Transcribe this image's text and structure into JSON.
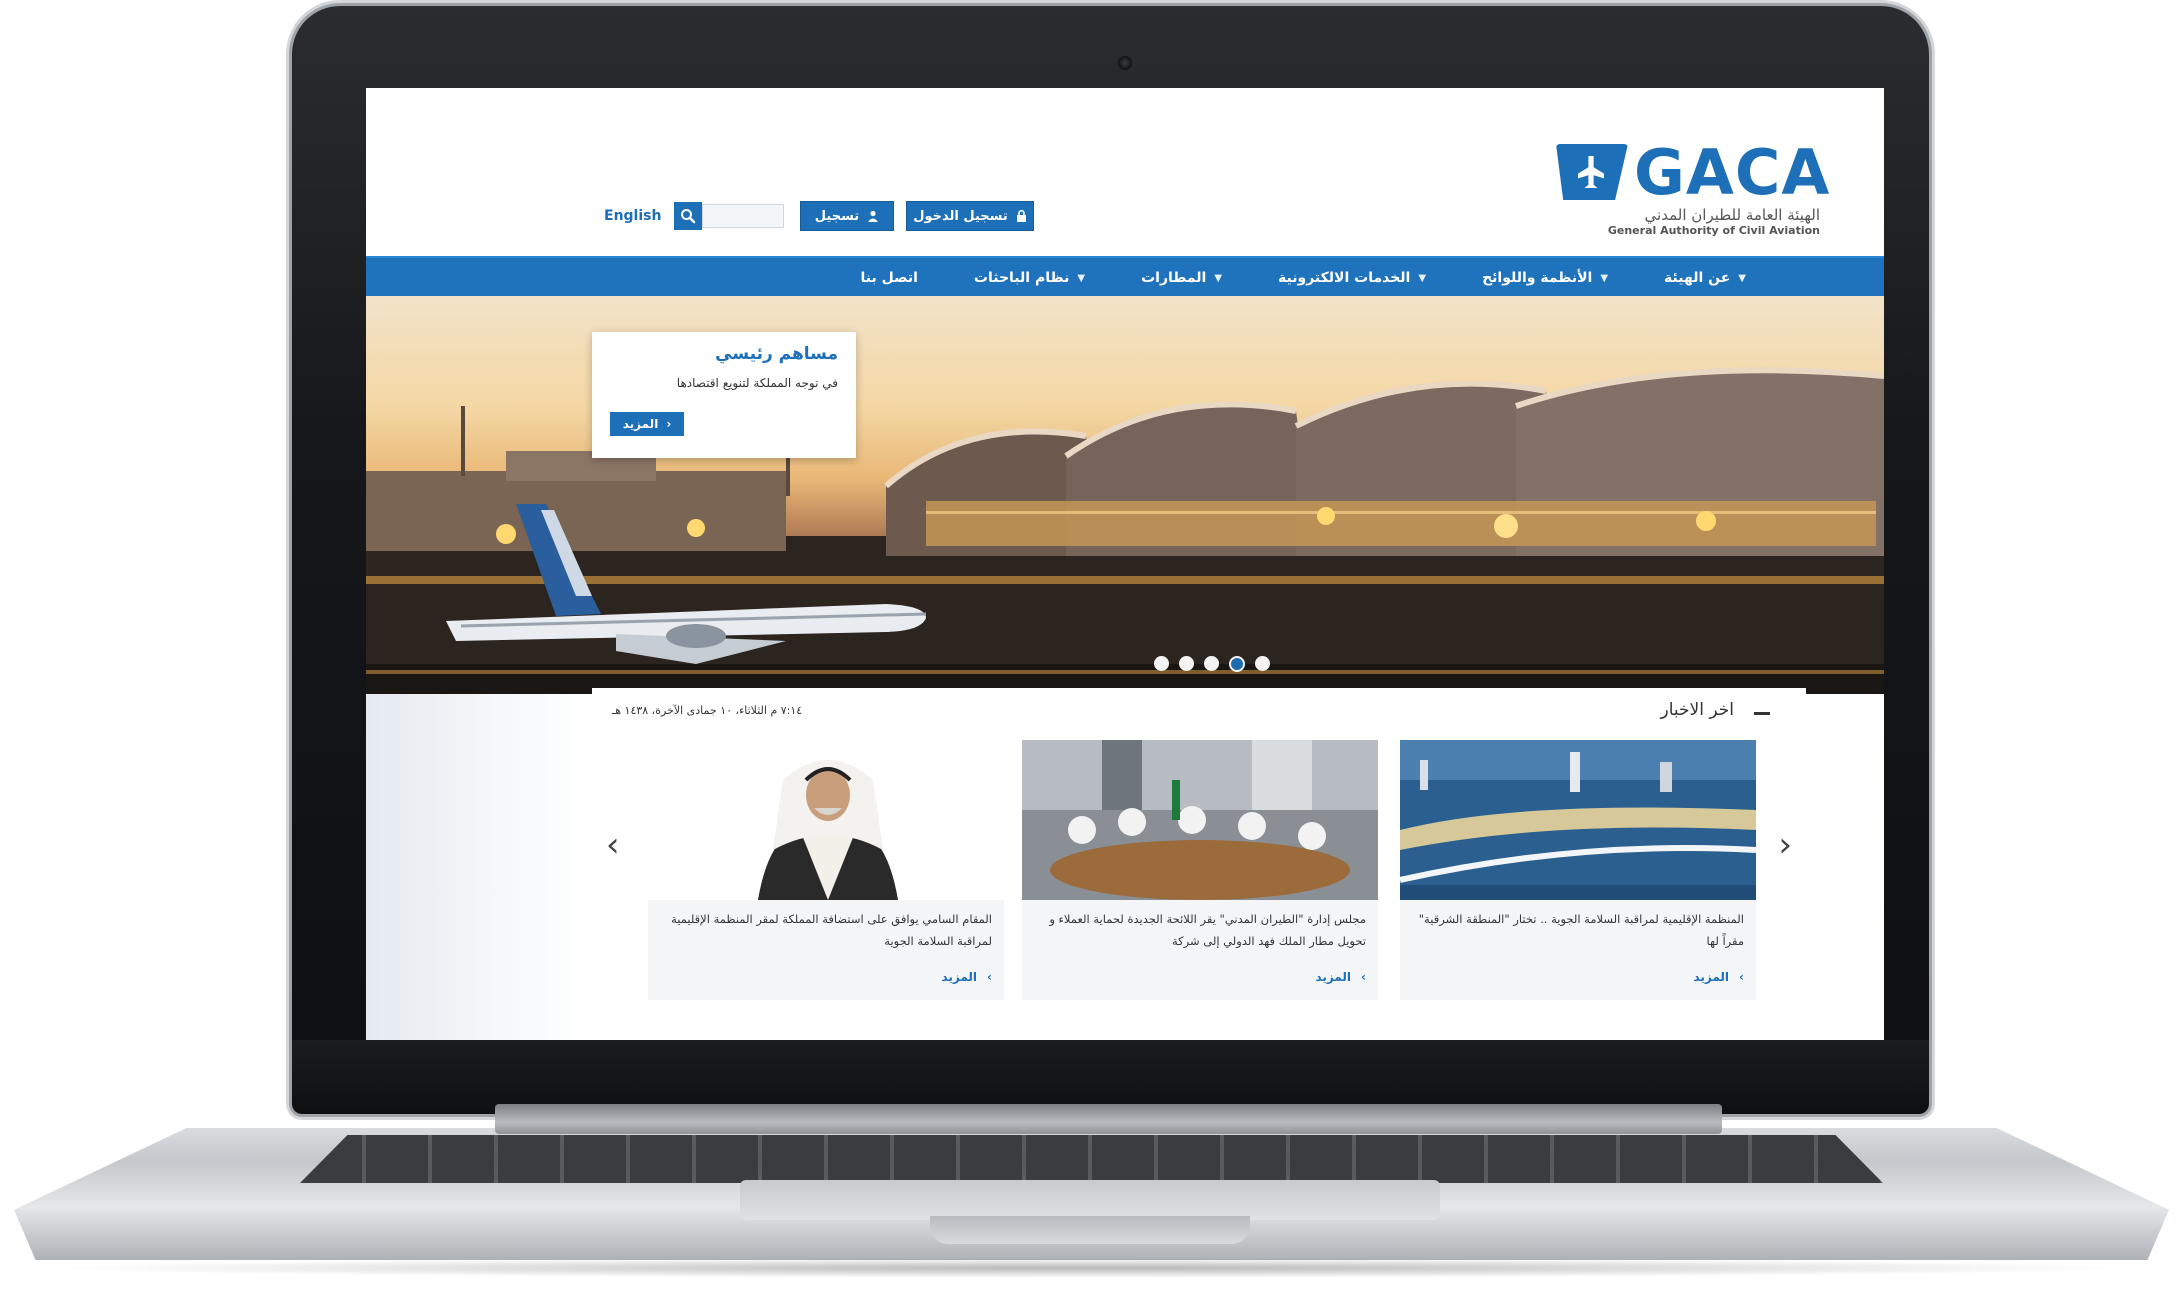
{
  "header": {
    "logo_text": "GACA",
    "logo_ar": "الهيئة العامة للطيران المدني",
    "logo_en": "General Authority of Civil Aviation",
    "lang_label": "English",
    "search_placeholder": "",
    "register_label": "تسجيل",
    "login_label": "تسجيل الدخول"
  },
  "nav": {
    "items": [
      {
        "label": "عن الهيئة"
      },
      {
        "label": "الأنظمة واللوائح"
      },
      {
        "label": "الخدمات الالكترونية"
      },
      {
        "label": "المطارات"
      },
      {
        "label": "نظام الباحثات"
      },
      {
        "label": "اتصل بنا"
      }
    ]
  },
  "hero": {
    "promo_title": "مساهم رئيسي",
    "promo_text": "في توجه المملكة لتنويع اقتصادها",
    "promo_button": "المزيد",
    "slides_count": 5,
    "active_slide": 4
  },
  "news": {
    "title": "اخر الاخبار",
    "date": "٧:١٤ م  الثلاثاء، ١٠ جمادى الآخرة، ١٤٣٨ هـ",
    "cards": [
      {
        "text": "المقام السامي يوافق على استضافة المملكة لمقر المنظمة الإقليمية لمراقبة السلامة الجوية",
        "more": "المزيد"
      },
      {
        "text": "مجلس إدارة \"الطيران المدني\" يقر اللائحة الجديدة لحماية العملاء و تحويل مطار الملك فهد الدولي إلى شركة",
        "more": "المزيد"
      },
      {
        "text": "المنظمة الإقليمية لمراقبة السلامة الجوية .. تختار \"المنطقة الشرقية\" مقراً لها",
        "more": "المزيد"
      }
    ]
  },
  "colors": {
    "brand": "#1d6fb8",
    "nav": "#1f72bc"
  }
}
